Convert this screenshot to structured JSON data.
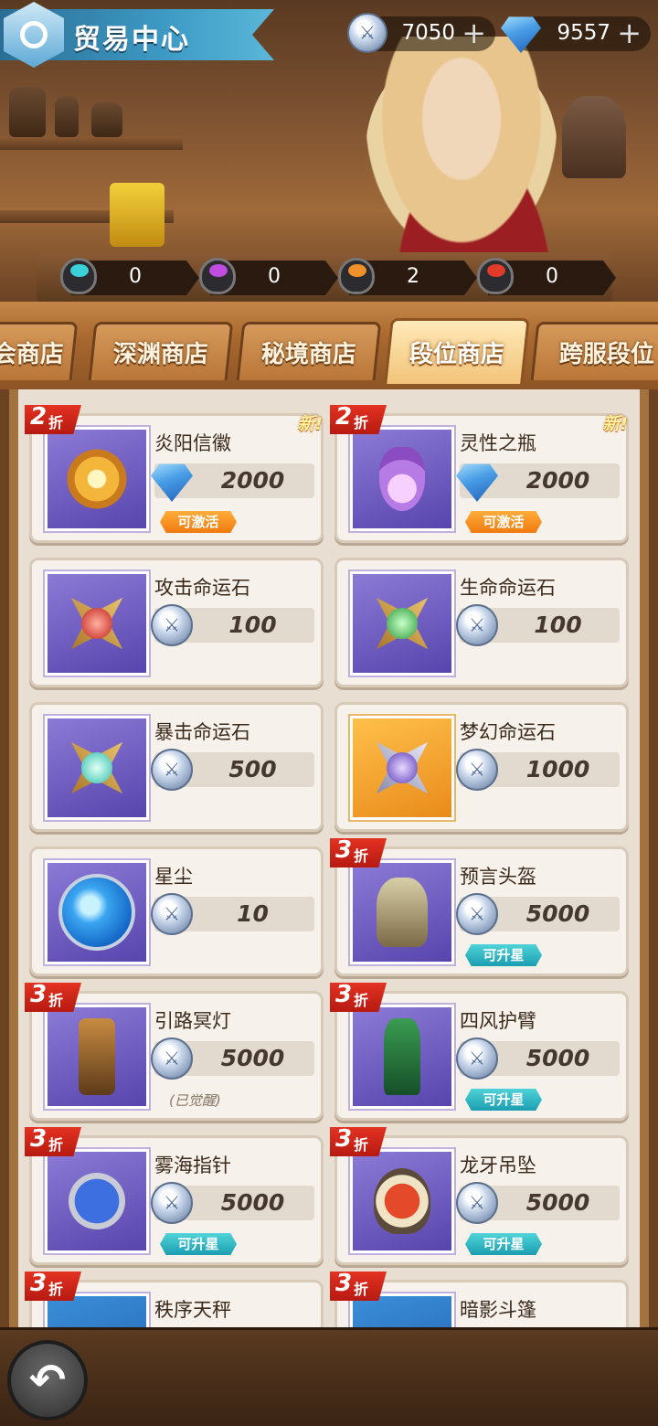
{
  "header": {
    "title": "贸易中心"
  },
  "currencies": [
    {
      "icon": "silver-coin-icon",
      "value": "7050",
      "plus": "+"
    },
    {
      "icon": "diamond-icon",
      "value": "9557",
      "plus": "+"
    }
  ],
  "tokens": [
    {
      "icon": "cyan-crystal-icon",
      "color": "#3ad1d8",
      "value": "0"
    },
    {
      "icon": "purple-crystal-icon",
      "color": "#c04ce0",
      "value": "0"
    },
    {
      "icon": "orange-crystal-icon",
      "color": "#f0902a",
      "value": "2"
    },
    {
      "icon": "red-crystal-icon",
      "color": "#e03a2a",
      "value": "0"
    }
  ],
  "tabs": [
    {
      "label": "会商店",
      "active": false
    },
    {
      "label": "深渊商店",
      "active": false
    },
    {
      "label": "秘境商店",
      "active": false
    },
    {
      "label": "段位商店",
      "active": true
    },
    {
      "label": "跨服段位",
      "active": false
    }
  ],
  "discount_suffix": "折",
  "new_label": "新!",
  "items": [
    {
      "name": "炎阳信徽",
      "price": "2000",
      "currency": "diamond",
      "discount": "2",
      "new": true,
      "tag": "可激活",
      "tag_color": "orange"
    },
    {
      "name": "灵性之瓶",
      "price": "2000",
      "currency": "diamond",
      "discount": "2",
      "new": true,
      "tag": "可激活",
      "tag_color": "orange"
    },
    {
      "name": "攻击命运石",
      "price": "100",
      "currency": "silver"
    },
    {
      "name": "生命命运石",
      "price": "100",
      "currency": "silver"
    },
    {
      "name": "暴击命运石",
      "price": "500",
      "currency": "silver"
    },
    {
      "name": "梦幻命运石",
      "price": "1000",
      "currency": "silver"
    },
    {
      "name": "星尘",
      "price": "10",
      "currency": "silver"
    },
    {
      "name": "预言头盔",
      "price": "5000",
      "currency": "silver",
      "discount": "3",
      "tag": "可升星",
      "tag_color": "teal"
    },
    {
      "name": "引路冥灯",
      "price": "5000",
      "currency": "silver",
      "discount": "3",
      "note": "(已觉醒)"
    },
    {
      "name": "四风护臂",
      "price": "5000",
      "currency": "silver",
      "discount": "3",
      "tag": "可升星",
      "tag_color": "teal"
    },
    {
      "name": "雾海指针",
      "price": "5000",
      "currency": "silver",
      "discount": "3",
      "tag": "可升星",
      "tag_color": "teal"
    },
    {
      "name": "龙牙吊坠",
      "price": "5000",
      "currency": "silver",
      "discount": "3",
      "tag": "可升星",
      "tag_color": "teal"
    },
    {
      "name": "秩序天秤",
      "discount": "3"
    },
    {
      "name": "暗影斗篷",
      "discount": "3"
    }
  ],
  "back_button": {
    "icon": "back-arrow-icon",
    "glyph": "↶"
  }
}
